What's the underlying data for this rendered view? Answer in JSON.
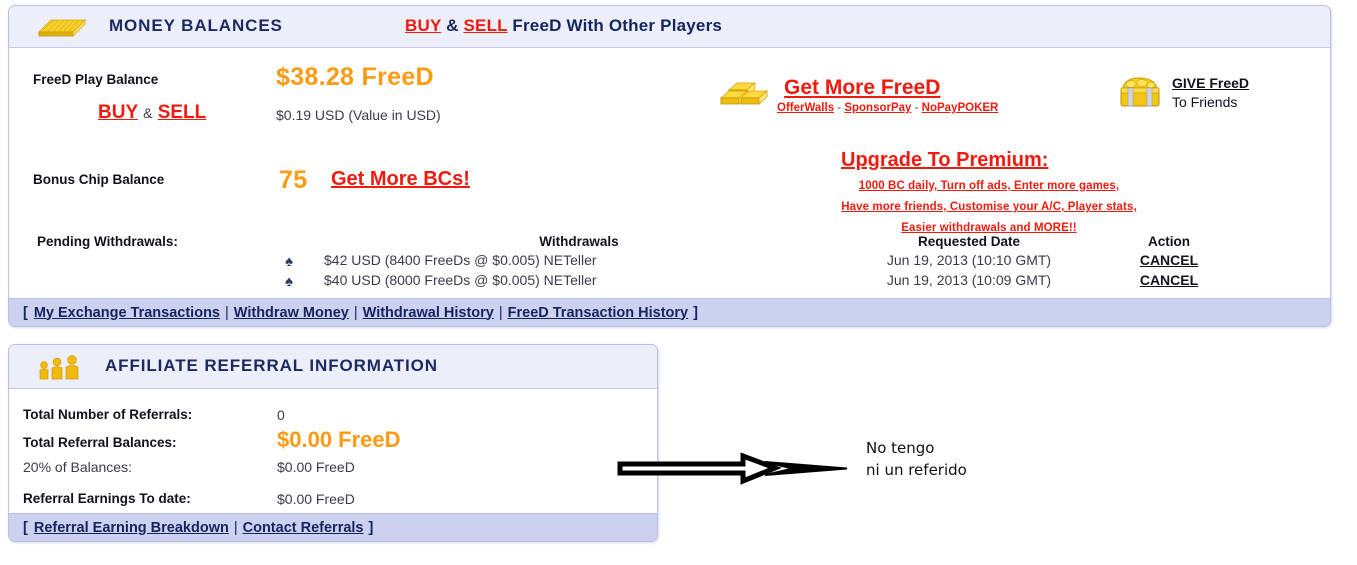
{
  "money_panel": {
    "icon": "money-stack-icon",
    "title": "MONEY BALANCES",
    "tagline": {
      "buy": "BUY",
      "amp": " & ",
      "sell": "SELL",
      "rest": " FreeD With Other Players"
    },
    "play_balance": {
      "label": "FreeD Play Balance",
      "amount": "$38.28 FreeD",
      "buy": "BUY",
      "amp": "&",
      "sell": "SELL",
      "usd_value": "$0.19 USD (Value in USD)"
    },
    "get_more": {
      "icon": "gold-bars-icon",
      "title": "Get More FreeD",
      "links": [
        "OfferWalls",
        "SponsorPay",
        "NoPayPOKER"
      ],
      "separator": "-"
    },
    "give_freed": {
      "icon": "gift-box-icon",
      "link": "GIVE FreeD",
      "subtitle": "To Friends"
    },
    "bonus_chip": {
      "label": "Bonus Chip Balance",
      "amount": "75",
      "link": "Get More BCs!"
    },
    "upgrade": {
      "title": "Upgrade To Premium:",
      "lines": [
        "1000 BC daily, Turn off ads, Enter more games,",
        "Have more friends, Customise your A/C, Player stats,",
        "Easier withdrawals and MORE!!"
      ]
    },
    "withdrawals": {
      "label": "Pending Withdrawals:",
      "columns": [
        "Withdrawals",
        "Requested Date",
        "Action"
      ],
      "rows": [
        {
          "icon": "spade-icon",
          "description": "$42 USD (8400 FreeDs @ $0.005) NETeller",
          "date": "Jun 19, 2013 (10:10 GMT)",
          "action": "CANCEL"
        },
        {
          "icon": "spade-icon",
          "description": "$40 USD (8000 FreeDs @ $0.005) NETeller",
          "date": "Jun 19, 2013 (10:09 GMT)",
          "action": "CANCEL"
        }
      ]
    },
    "navbar": {
      "open": "[",
      "close": "]",
      "separator": "|",
      "links": [
        "My Exchange Transactions",
        "Withdraw Money",
        "Withdrawal History",
        "FreeD Transaction History"
      ]
    }
  },
  "affiliate_panel": {
    "icon": "people-group-icon",
    "title": "AFFILIATE REFERRAL INFORMATION",
    "rows": [
      {
        "label": "Total Number of Referrals:",
        "value": "0"
      },
      {
        "label": "Total Referral Balances:",
        "value": "$0.00 FreeD"
      },
      {
        "label": "20% of Balances:",
        "value": "$0.00 FreeD"
      },
      {
        "label": "Referral Earnings To date:",
        "value": "$0.00 FreeD"
      }
    ],
    "navbar": {
      "open": "[",
      "close": "]",
      "separator": "|",
      "links": [
        "Referral Earning Breakdown",
        "Contact Referrals"
      ]
    }
  },
  "annotation": {
    "arrow": "right-arrow-annotation",
    "line1": "No tengo",
    "line2": "ni un referido"
  },
  "colors": {
    "orange": "#ff9a11",
    "red": "#ef1b0e",
    "navy": "#14255e",
    "header_bg": "#eceef9",
    "navbar_bg": "#ccd1ef",
    "border": "#b9bfe6"
  }
}
